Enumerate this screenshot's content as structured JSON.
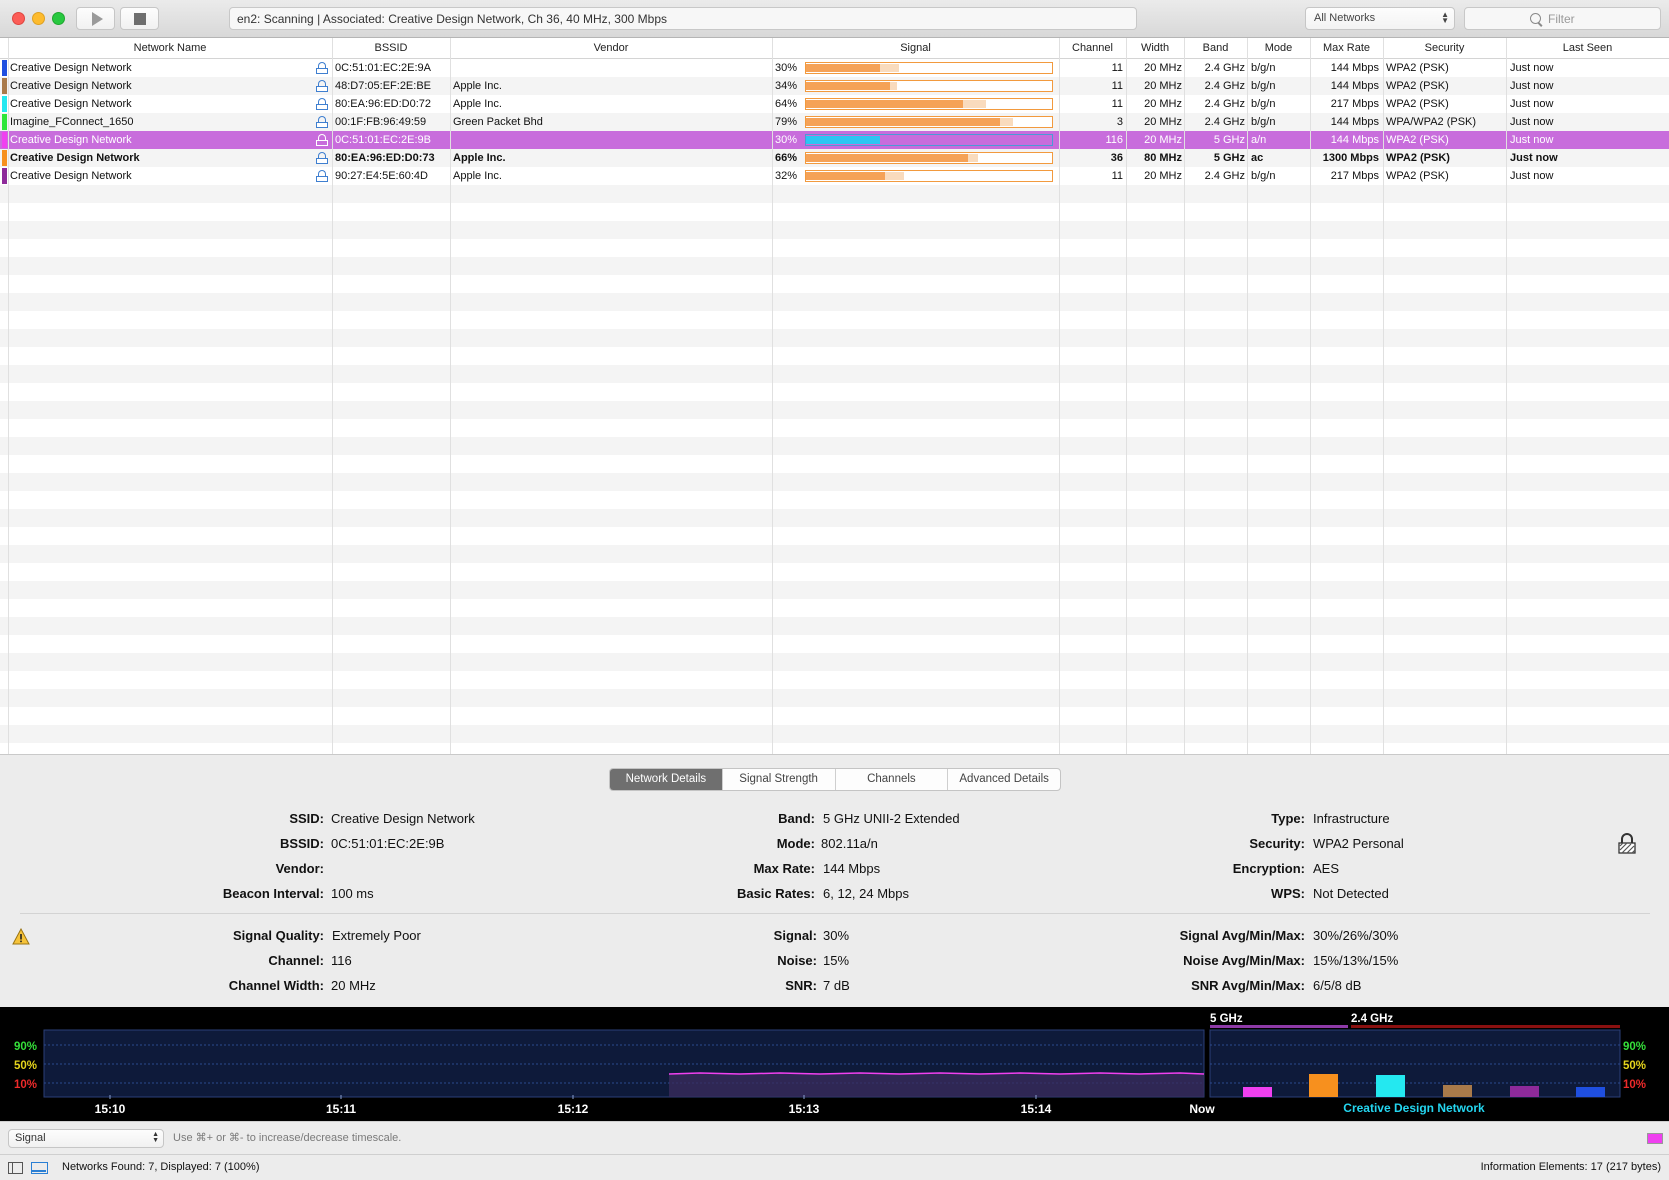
{
  "toolbar": {
    "status": "en2: Scanning  |  Associated: Creative Design Network, Ch 36, 40 MHz, 300 Mbps",
    "network_filter": "All Networks",
    "filter_placeholder": "Filter"
  },
  "table": {
    "columns": [
      "Network Name",
      "BSSID",
      "Vendor",
      "Signal",
      "Channel",
      "Width",
      "Band",
      "Mode",
      "Max Rate",
      "Security",
      "Last Seen"
    ],
    "rows": [
      {
        "color": "#1f4fe0",
        "name": "Creative Design Network",
        "bssid": "0C:51:01:EC:2E:9A",
        "vendor": "",
        "signal": "30%",
        "signal_value": 30,
        "signal_avg": 38,
        "channel": "11",
        "width": "20 MHz",
        "band": "2.4 GHz",
        "mode": "b/g/n",
        "max_rate": "144 Mbps",
        "security": "WPA2 (PSK)",
        "last_seen": "Just now",
        "selected": false,
        "associated": false
      },
      {
        "color": "#a97a4a",
        "name": "Creative Design Network",
        "bssid": "48:D7:05:EF:2E:BE",
        "vendor": "Apple Inc.",
        "signal": "34%",
        "signal_value": 34,
        "signal_avg": 37,
        "channel": "11",
        "width": "20 MHz",
        "band": "2.4 GHz",
        "mode": "b/g/n",
        "max_rate": "144 Mbps",
        "security": "WPA2 (PSK)",
        "last_seen": "Just now",
        "selected": false,
        "associated": false
      },
      {
        "color": "#24e8f0",
        "name": "Creative Design Network",
        "bssid": "80:EA:96:ED:D0:72",
        "vendor": "Apple Inc.",
        "signal": "64%",
        "signal_value": 64,
        "signal_avg": 73,
        "channel": "11",
        "width": "20 MHz",
        "band": "2.4 GHz",
        "mode": "b/g/n",
        "max_rate": "217 Mbps",
        "security": "WPA2 (PSK)",
        "last_seen": "Just now",
        "selected": false,
        "associated": false
      },
      {
        "color": "#2ee63a",
        "name": "Imagine_FConnect_1650",
        "bssid": "00:1F:FB:96:49:59",
        "vendor": "Green Packet Bhd",
        "signal": "79%",
        "signal_value": 79,
        "signal_avg": 84,
        "channel": "3",
        "width": "20 MHz",
        "band": "2.4 GHz",
        "mode": "b/g/n",
        "max_rate": "144 Mbps",
        "security": "WPA/WPA2 (PSK)",
        "last_seen": "Just now",
        "selected": false,
        "associated": false
      },
      {
        "color": "#f040f0",
        "name": "Creative Design Network",
        "bssid": "0C:51:01:EC:2E:9B",
        "vendor": "",
        "signal": "30%",
        "signal_value": 30,
        "signal_avg": 30,
        "channel": "116",
        "width": "20 MHz",
        "band": "5 GHz",
        "mode": "a/n",
        "max_rate": "144 Mbps",
        "security": "WPA2 (PSK)",
        "last_seen": "Just now",
        "selected": true,
        "associated": false
      },
      {
        "color": "#f7901e",
        "name": "Creative Design Network",
        "bssid": "80:EA:96:ED:D0:73",
        "vendor": "Apple Inc.",
        "signal": "66%",
        "signal_value": 66,
        "signal_avg": 70,
        "channel": "36",
        "width": "80 MHz",
        "band": "5 GHz",
        "mode": "ac",
        "max_rate": "1300 Mbps",
        "security": "WPA2 (PSK)",
        "last_seen": "Just now",
        "selected": false,
        "associated": true
      },
      {
        "color": "#8e2a9a",
        "name": "Creative Design Network",
        "bssid": "90:27:E4:5E:60:4D",
        "vendor": "Apple Inc.",
        "signal": "32%",
        "signal_value": 32,
        "signal_avg": 40,
        "channel": "11",
        "width": "20 MHz",
        "band": "2.4 GHz",
        "mode": "b/g/n",
        "max_rate": "217 Mbps",
        "security": "WPA2 (PSK)",
        "last_seen": "Just now",
        "selected": false,
        "associated": false
      }
    ]
  },
  "tabs": [
    "Network Details",
    "Signal Strength",
    "Channels",
    "Advanced Details"
  ],
  "details": {
    "ssid_label": "SSID:",
    "ssid": "Creative Design Network",
    "bssid_label": "BSSID:",
    "bssid": "0C:51:01:EC:2E:9B",
    "vendor_label": "Vendor:",
    "vendor": "",
    "beacon_label": "Beacon Interval:",
    "beacon": "100 ms",
    "band_label": "Band:",
    "band": "5 GHz UNII-2 Extended",
    "mode_label": "Mode:",
    "mode": "802.11a/n",
    "maxrate_label": "Max Rate:",
    "maxrate": "144 Mbps",
    "basic_label": "Basic Rates:",
    "basic": "6, 12, 24 Mbps",
    "type_label": "Type:",
    "type": "Infrastructure",
    "security_label": "Security:",
    "security": "WPA2 Personal",
    "encryption_label": "Encryption:",
    "encryption": "AES",
    "wps_label": "WPS:",
    "wps": "Not Detected",
    "quality_label": "Signal Quality:",
    "quality": "Extremely Poor",
    "channel_label": "Channel:",
    "channel": "116",
    "chwidth_label": "Channel Width:",
    "chwidth": "20 MHz",
    "signal_label": "Signal:",
    "signal": "30%",
    "noise_label": "Noise:",
    "noise": "15%",
    "snr_label": "SNR:",
    "snr": "7 dB",
    "sigavg_label": "Signal Avg/Min/Max:",
    "sigavg": "30%/26%/30%",
    "noiseavg_label": "Noise Avg/Min/Max:",
    "noiseavg": "15%/13%/15%",
    "snravg_label": "SNR Avg/Min/Max:",
    "snravg": "6/5/8 dB"
  },
  "graph": {
    "y_labels": [
      {
        "text": "90%",
        "color": "#35e03a"
      },
      {
        "text": "50%",
        "color": "#e6d51c"
      },
      {
        "text": "10%",
        "color": "#ee2a2a"
      }
    ],
    "time_labels": [
      "15:10",
      "15:11",
      "15:12",
      "15:13",
      "15:14",
      "Now"
    ],
    "band_labels": [
      "5 GHz",
      "2.4 GHz"
    ],
    "selected_network": "Creative Design Network",
    "history_line_color": "#f040f0",
    "bars": [
      {
        "color": "#f040f0",
        "value": 30
      },
      {
        "color": "#f7901e",
        "value": 66
      },
      {
        "color": "#24e8f0",
        "value": 64
      },
      {
        "color": "#a97a4a",
        "value": 34
      },
      {
        "color": "#8e2a9a",
        "value": 32
      },
      {
        "color": "#1f4fe0",
        "value": 30
      }
    ]
  },
  "graph_status": {
    "mode": "Signal",
    "hint": "Use ⌘+ or ⌘- to increase/decrease timescale."
  },
  "bottom": {
    "networks_found": "Networks Found: 7, Displayed: 7 (100%)",
    "info_elements": "Information Elements: 17 (217 bytes)"
  }
}
